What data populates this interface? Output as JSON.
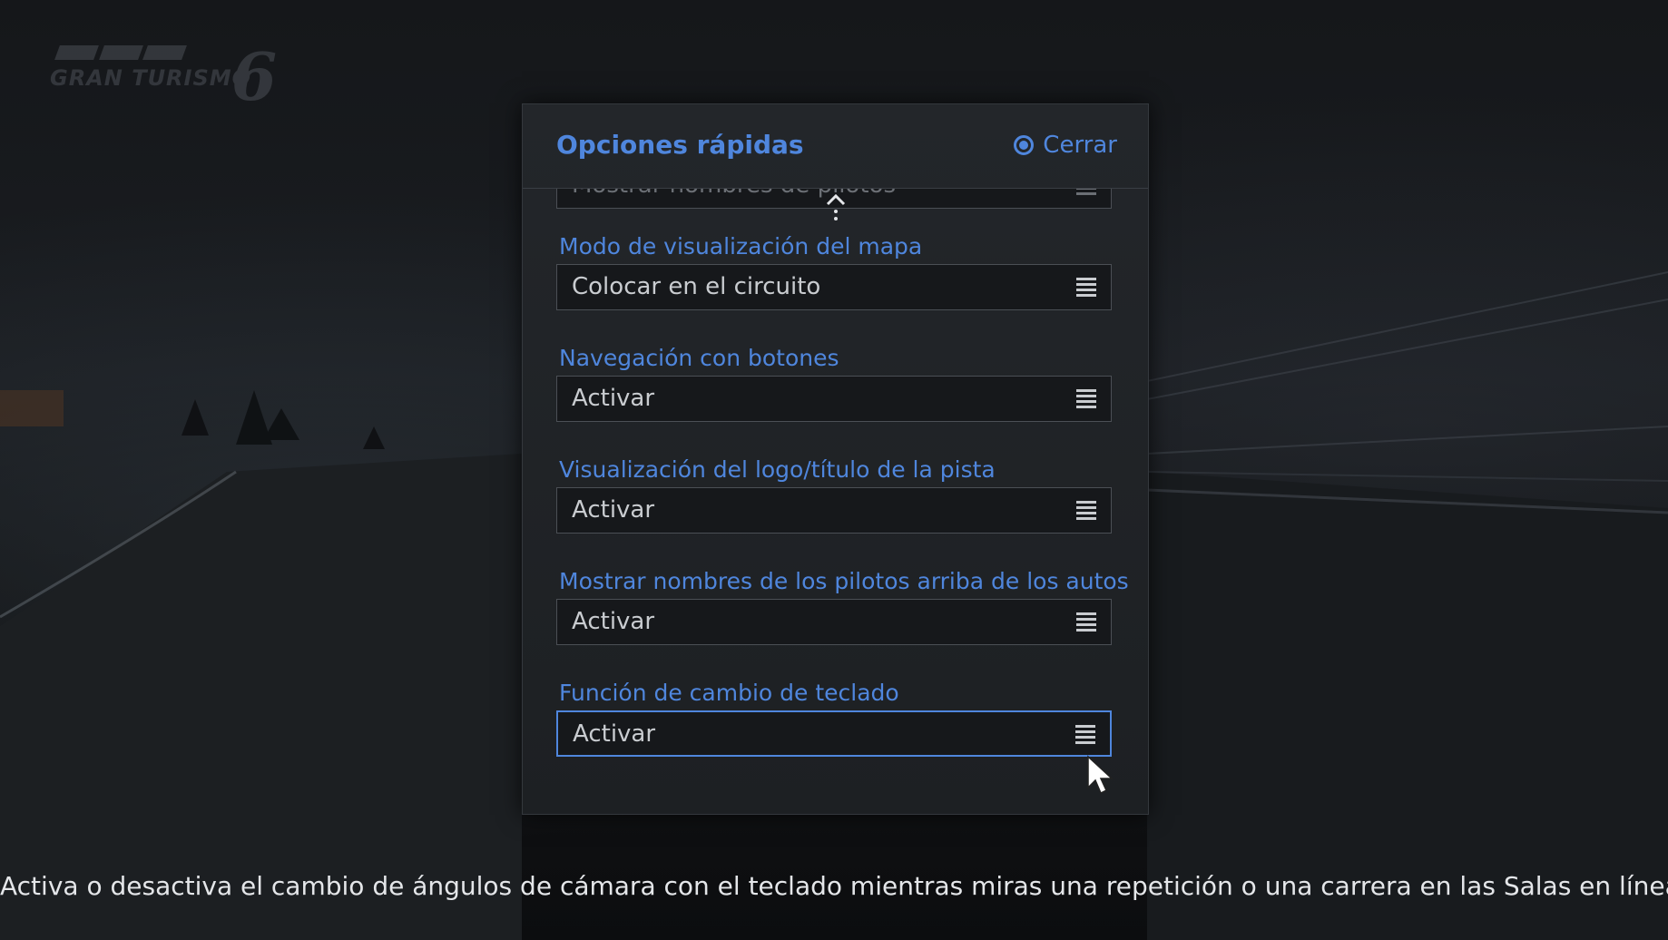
{
  "logo": {
    "text": "GRAN TURISMO",
    "number": "6"
  },
  "dialog": {
    "title": "Opciones rápidas",
    "close_label": "Cerrar",
    "close_icon": "circle-button-icon"
  },
  "options": [
    {
      "label": "",
      "value": "Mostrar nombres de pilotos",
      "state": "faded"
    },
    {
      "label": "Modo de visualización del mapa",
      "value": "Colocar en el circuito",
      "state": "normal"
    },
    {
      "label": "Navegación con botones",
      "value": "Activar",
      "state": "normal"
    },
    {
      "label": "Visualización del logo/título de la pista",
      "value": "Activar",
      "state": "normal"
    },
    {
      "label": "Mostrar nombres de los pilotos arriba de los autos",
      "value": "Activar",
      "state": "normal"
    },
    {
      "label": "Función de cambio de teclado",
      "value": "Activar",
      "state": "selected"
    }
  ],
  "help_text": "Activa o desactiva el cambio de ángulos de cámara con el teclado mientras miras una repetición o una carrera en las Salas en línea.",
  "colors": {
    "accent": "#4f86dd",
    "panel": "#202327",
    "text": "#c9ccd0"
  }
}
